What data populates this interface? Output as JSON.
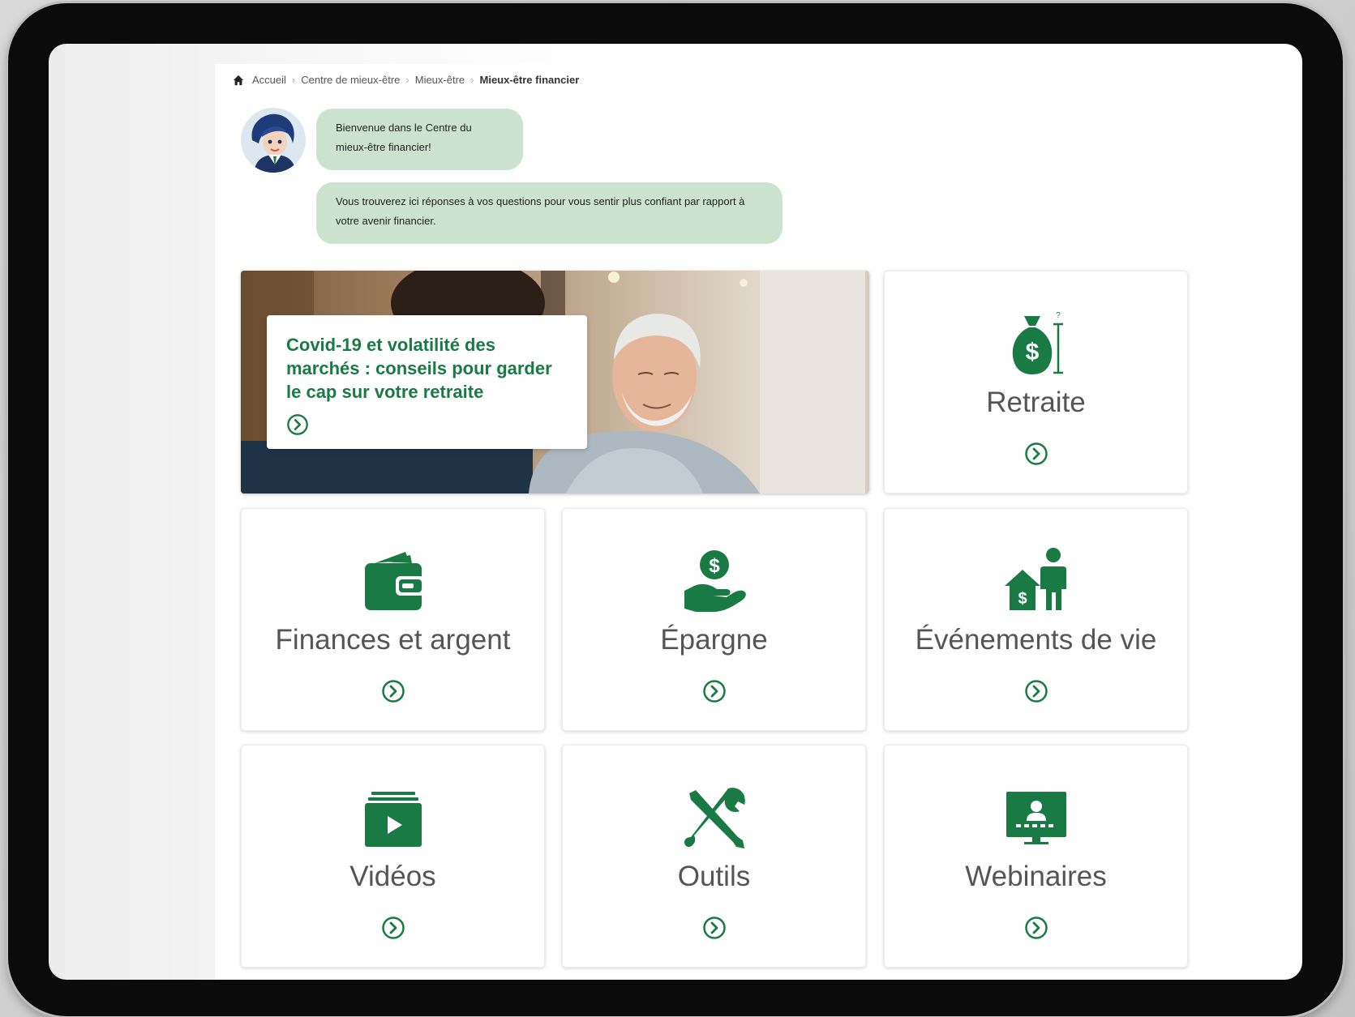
{
  "breadcrumb": {
    "home": "Accueil",
    "level2": "Centre de mieux-être",
    "level3": "Mieux-être",
    "current": "Mieux-être financier"
  },
  "chat": {
    "message1": "Bienvenue dans le Centre du mieux-être financier!",
    "message2": "Vous trouverez ici réponses à vos questions pour vous sentir plus confiant par rapport à votre avenir financier."
  },
  "hero": {
    "title": "Covid-19 et volatilité des marchés : conseils pour garder le cap sur votre retraite"
  },
  "tiles": {
    "retraite": "Retraite",
    "finances": "Finances et argent",
    "epargne": "Épargne",
    "evenements": "Événements de vie",
    "videos": "Vidéos",
    "outils": "Outils",
    "webinaires": "Webinaires"
  },
  "colors": {
    "brand_green": "#1a7a44",
    "bubble_green": "#cce3cf"
  }
}
